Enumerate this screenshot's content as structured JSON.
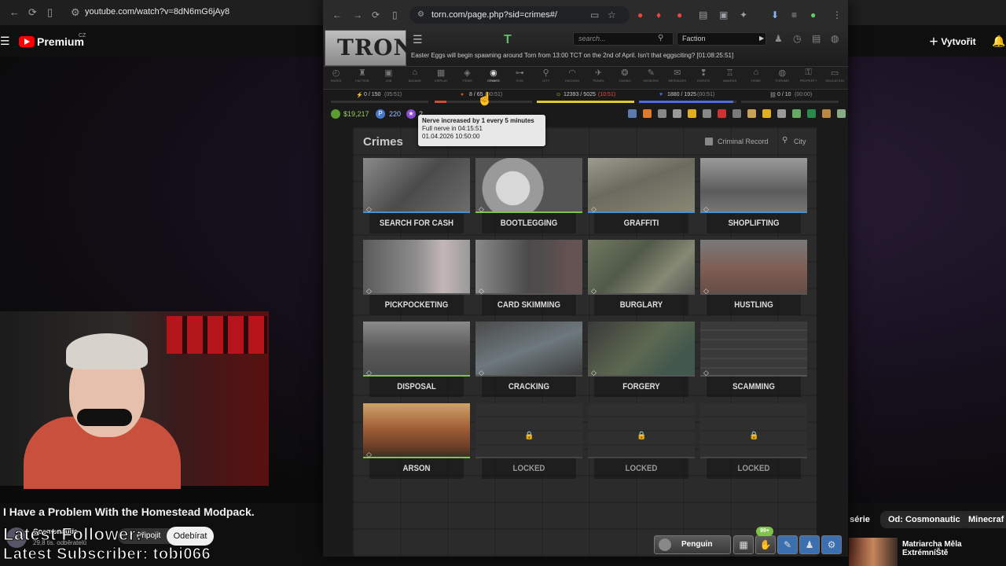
{
  "youtube": {
    "url": "youtube.com/watch?v=8dN6mG6jAy8",
    "brand": "Premium",
    "region": "CZ",
    "create_label": "Vytvořit",
    "video_title": "I Have a Problem With the Homestead Modpack.",
    "channel_name": "Cosmonautic",
    "subscribers": "29,8 tis. odběratelů",
    "join_label": "Připojit",
    "unsubscribe_label": "Odebírat",
    "overlay_follower": "Latest Follower:",
    "overlay_subscriber": "Latest Subscriber: tobi066",
    "chips": [
      "é série",
      "Od: Cosmonautic",
      "Minecraf"
    ],
    "rec_title": "Matriarcha Měla ExtrémníŠtě"
  },
  "torn": {
    "url": "torn.com/page.php?sid=crimes#/",
    "logo": "TRON",
    "search_placeholder": "search...",
    "faction_label": "Faction",
    "news": "Easter Eggs will begin spawning around Torn from 13:00 TCT on the 2nd of April. Isn't that eggsciting? [01:08:25:51]",
    "nav": [
      {
        "label": "Pages",
        "icon": "◴"
      },
      {
        "label": "Faction",
        "icon": "♜"
      },
      {
        "label": "Job",
        "icon": "▣"
      },
      {
        "label": "Bazaar",
        "icon": "⌂"
      },
      {
        "label": "Display",
        "icon": "▦"
      },
      {
        "label": "Items",
        "icon": "◈"
      },
      {
        "label": "Crimes",
        "icon": "◉"
      },
      {
        "label": "Gym",
        "icon": "⊶"
      },
      {
        "label": "City",
        "icon": "⚲"
      },
      {
        "label": "Hacking",
        "icon": "◠"
      },
      {
        "label": "Travel",
        "icon": "✈"
      },
      {
        "label": "Casino",
        "icon": "❂"
      },
      {
        "label": "Missions",
        "icon": "✎"
      },
      {
        "label": "Messages",
        "icon": "✉"
      },
      {
        "label": "Events",
        "icon": "❢"
      },
      {
        "label": "Awards",
        "icon": "♖"
      },
      {
        "label": "Home",
        "icon": "⌂"
      },
      {
        "label": "Forums",
        "icon": "◍"
      },
      {
        "label": "Property",
        "icon": "⚿"
      },
      {
        "label": "Education",
        "icon": "▭"
      }
    ],
    "bars": {
      "energy": {
        "text": "0 / 150",
        "timer": "(05:51)",
        "fill": 0,
        "color": "#7ec83c"
      },
      "nerve": {
        "text": "8 / 65",
        "timer": "(00:51)",
        "fill": 0.12,
        "color": "#d84a2a"
      },
      "happy": {
        "text": "12393 / 5025",
        "timer": "(10:51)",
        "fill": 1,
        "color": "#e2c62c"
      },
      "life": {
        "text": "1880 / 1925",
        "timer": "(00:51)",
        "fill": 0.97,
        "color": "#4a6ee2"
      },
      "chain": {
        "text": "0 / 10",
        "timer": "(00:00)",
        "fill": 0,
        "color": "#888888"
      }
    },
    "money": "$19,217",
    "points": "220",
    "merits": "2",
    "tooltip": {
      "line1": "Nerve increased by 1 every 5 minutes",
      "line2": "Full nerve in 04:15:51",
      "line3": "01.04.2026 10:50:00"
    },
    "crimes_title": "Crimes",
    "criminal_record": "Criminal Record",
    "city": "City",
    "cards": [
      {
        "label": "SEARCH FOR CASH",
        "locked": false,
        "bg": "linear-gradient(135deg,#8a8a8a,#4b4b4b 50%,#6d6d6d)",
        "line": "#4a90d0"
      },
      {
        "label": "BOOTLEGGING",
        "locked": false,
        "bg": "radial-gradient(circle at 35% 55%,#d8d8d8 0 22%,#9a9a9a 23% 40%,#555 41%)",
        "line": "#7fc44a"
      },
      {
        "label": "GRAFFITI",
        "locked": false,
        "bg": "linear-gradient(160deg,#9b9b8a,#6a6a5a 45%,#8a8a70)",
        "line": "#4a90d0"
      },
      {
        "label": "SHOPLIFTING",
        "locked": false,
        "bg": "linear-gradient(180deg,#9a9a9a,#5c5c5c 60%,#777)",
        "line": "#4a90d0"
      },
      {
        "label": "PICKPOCKETING",
        "locked": false,
        "bg": "linear-gradient(90deg,#5a5a5a,#8d8d8d 50%,#c9b5b5 75%,#999)",
        "line": "#555"
      },
      {
        "label": "CARD SKIMMING",
        "locked": false,
        "bg": "linear-gradient(90deg,#8a8a8a,#4a4a4a 50%,#6b5050 90%)",
        "line": "#555"
      },
      {
        "label": "BURGLARY",
        "locked": false,
        "bg": "linear-gradient(135deg,#6e7a55,#4f5a44 40%,#858a6a 70%,#555)",
        "line": "#555"
      },
      {
        "label": "HUSTLING",
        "locked": false,
        "bg": "linear-gradient(180deg,#7a7a7a,#8a5a4a 55%,#6a4a40)",
        "line": "#555"
      },
      {
        "label": "DISPOSAL",
        "locked": false,
        "bg": "linear-gradient(180deg,#8a8a8a,#5a5a5a 50%,#4a4a4a)",
        "line": "#7fc44a"
      },
      {
        "label": "CRACKING",
        "locked": false,
        "bg": "linear-gradient(160deg,#4a4a4a,#6a7a80 50%,#3a3a3a)",
        "line": "#555"
      },
      {
        "label": "FORGERY",
        "locked": false,
        "bg": "linear-gradient(135deg,#3a3a3a,#5a6a48 50%,#3a5a4a 80%)",
        "line": "#555"
      },
      {
        "label": "SCAMMING",
        "locked": false,
        "bg": "repeating-linear-gradient(0deg,#3a3a3a 0 10px,#444 10px 12px)",
        "line": "#555"
      },
      {
        "label": "ARSON",
        "locked": false,
        "bg": "linear-gradient(180deg,#e0a050,#b85a20 45%,#7a3a1a 80%,#3a2a20)",
        "line": "#7fc44a"
      },
      {
        "label": "LOCKED",
        "locked": true,
        "bg": "",
        "line": "#444"
      },
      {
        "label": "LOCKED",
        "locked": true,
        "bg": "",
        "line": "#444"
      },
      {
        "label": "LOCKED",
        "locked": true,
        "bg": "",
        "line": "#444"
      }
    ],
    "player_name": "Penguin",
    "notif_badge": "99+"
  }
}
